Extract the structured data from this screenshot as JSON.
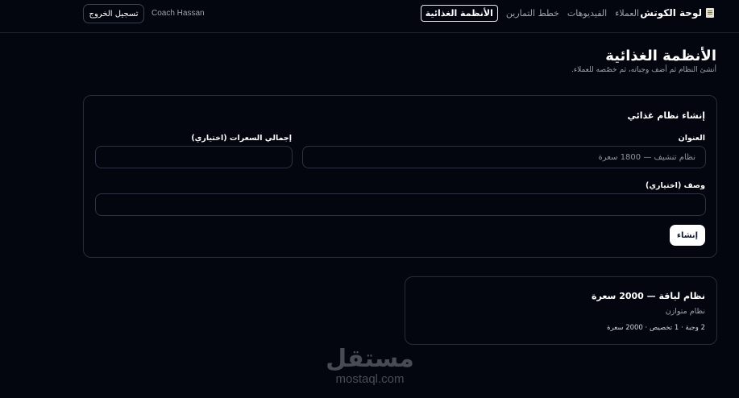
{
  "header": {
    "brand": "لوحة الكوتش",
    "brand_icon": "clipboard-icon",
    "nav": [
      {
        "label": "العملاء",
        "active": false
      },
      {
        "label": "الفيديوهات",
        "active": false
      },
      {
        "label": "خطط التمارين",
        "active": false
      },
      {
        "label": "الأنظمة الغذائية",
        "active": true
      }
    ],
    "user": "Coach Hassan",
    "logout": "تسجيل الخروج"
  },
  "page": {
    "title": "الأنظمة الغذائية",
    "subtitle": "أنشئ النظام ثم أضف وجباته، ثم خصّصه للعملاء."
  },
  "create_form": {
    "heading": "إنشاء نظام غذائي",
    "title_label": "العنوان",
    "title_placeholder": "نظام تنشيف — 1800 سعرة",
    "title_value": "",
    "calories_label": "إجمالي السعرات (اختياري)",
    "calories_value": "",
    "description_label": "وصف (اختياري)",
    "description_value": "",
    "submit": "إنشاء"
  },
  "plans": [
    {
      "title": "نظام لياقة — 2000 سعرة",
      "description": "نظام متوازن",
      "meta": "2 وجبة · 1 تخصيص · 2000 سعرة"
    }
  ],
  "watermark": {
    "arabic": "مستقل",
    "latin": "mostaql.com"
  },
  "colors": {
    "background": "#04060f",
    "border": "#262c3a",
    "muted": "#9ca3af",
    "primary_button": "#ffffff"
  }
}
